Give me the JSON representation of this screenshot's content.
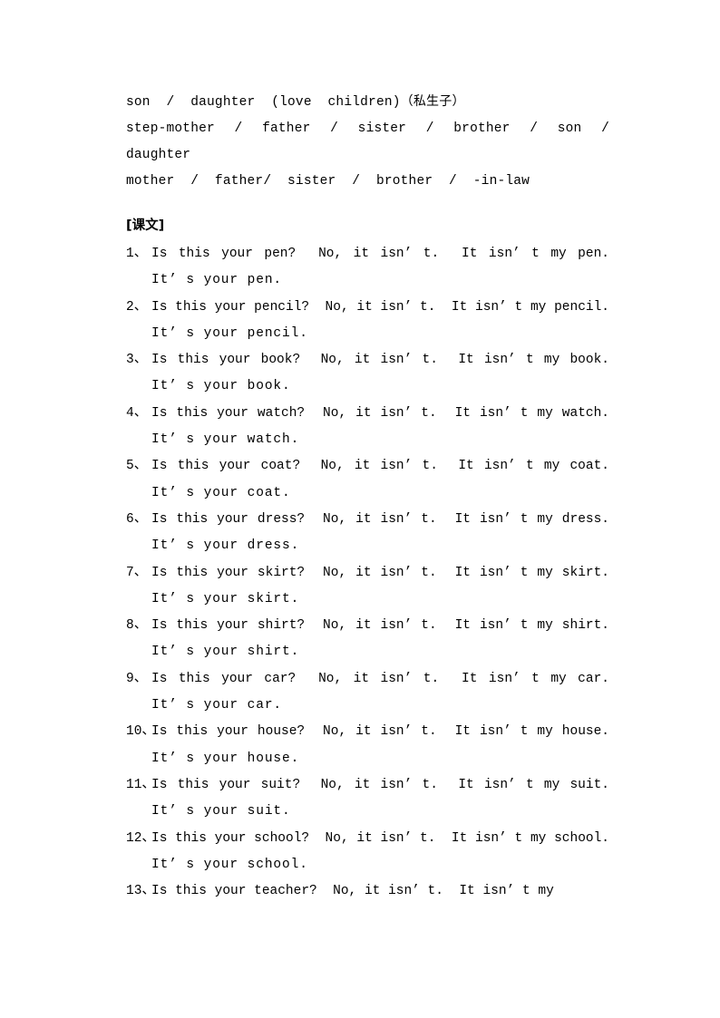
{
  "document": {
    "vocabulary": {
      "lines": [
        "son  /  daughter  (love  children)",
        "step-mother  /  father  /  sister  /  brother  /  son  /",
        "daughter",
        "mother  /  father/  sister  /  brother  /  -in-law"
      ],
      "line1_cjk_suffix": "（私生子）"
    },
    "section_heading": "[课文]",
    "drills": [
      {
        "number": "1、",
        "question": "Is this your pen?  No, it isn’ t.  It isn’ t my pen.",
        "answer": "It’ s your pen."
      },
      {
        "number": "2、",
        "question": "Is this your pencil?  No, it isn’ t.  It isn’ t my pencil.",
        "answer": "It’ s your pencil."
      },
      {
        "number": "3、",
        "question": "Is this your book?  No, it isn’ t.  It isn’ t my book.",
        "answer": "It’ s your book."
      },
      {
        "number": "4、",
        "question": "Is this your watch?  No, it isn’ t.  It isn’ t my watch.",
        "answer": "It’ s your watch."
      },
      {
        "number": "5、",
        "question": "Is this your coat?  No, it isn’ t.  It isn’ t my coat.",
        "answer": "It’ s your coat."
      },
      {
        "number": "6、",
        "question": "Is this your dress?  No, it isn’ t.  It isn’ t my dress.",
        "answer": "It’ s your dress."
      },
      {
        "number": "7、",
        "question": "Is this your skirt?  No, it isn’ t.  It isn’ t my skirt.",
        "answer": "It’ s your skirt."
      },
      {
        "number": "8、",
        "question": "Is this your shirt?  No, it isn’ t.  It isn’ t my shirt.",
        "answer": "It’ s your shirt."
      },
      {
        "number": "9、",
        "question": "Is this your car?  No, it isn’ t.  It isn’ t my car.",
        "answer": "It’ s your car."
      },
      {
        "number": "10、",
        "question": "Is this your house?  No, it isn’ t.  It isn’ t my house.",
        "answer": "It’ s your house."
      },
      {
        "number": "11、",
        "question": "Is this your suit?  No, it isn’ t.  It isn’ t my suit.",
        "answer": "It’ s your suit."
      },
      {
        "number": "12、",
        "question": "Is this your school?  No, it isn’ t.  It isn’ t my school.",
        "answer": "It’ s your school."
      },
      {
        "number": "13、",
        "question": "Is this your teacher?  No, it isn’ t.  It isn’ t my",
        "answer": ""
      }
    ]
  }
}
